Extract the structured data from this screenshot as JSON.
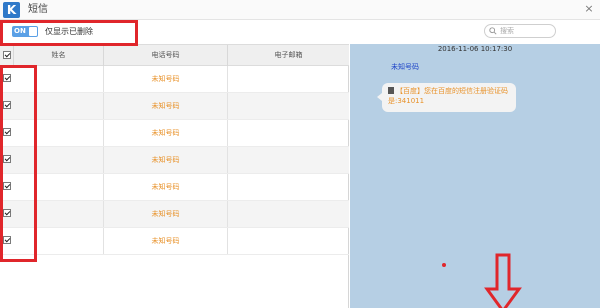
{
  "window": {
    "logo_letter": "K",
    "title": "短信",
    "close_label": "×"
  },
  "toolbar": {
    "toggle_label": "ON",
    "toggle_state": "on",
    "filter_label": "仅显示已删除",
    "search_placeholder": "搜索"
  },
  "table": {
    "headers": [
      "姓名",
      "电话号码",
      "电子邮箱"
    ],
    "header_checked": true,
    "rows": [
      {
        "checked": true,
        "name": "",
        "phone": "未知号码",
        "email": ""
      },
      {
        "checked": true,
        "name": "",
        "phone": "未知号码",
        "email": ""
      },
      {
        "checked": true,
        "name": "",
        "phone": "未知号码",
        "email": ""
      },
      {
        "checked": true,
        "name": "",
        "phone": "未知号码",
        "email": ""
      },
      {
        "checked": true,
        "name": "",
        "phone": "未知号码",
        "email": ""
      },
      {
        "checked": true,
        "name": "",
        "phone": "未知号码",
        "email": ""
      },
      {
        "checked": true,
        "name": "",
        "phone": "未知号码",
        "email": ""
      }
    ]
  },
  "conversation": {
    "timestamp": "2016-11-06 10:17:30",
    "sender": "未知号码",
    "message": "【百度】您在百度的短信注册验证码是:341011"
  },
  "colors": {
    "accent": "#2f79c9",
    "phone_text": "#e8922a",
    "sender_text": "#1f45c8",
    "chat_background": "#b6cfe4",
    "annotation": "#e0262b"
  }
}
